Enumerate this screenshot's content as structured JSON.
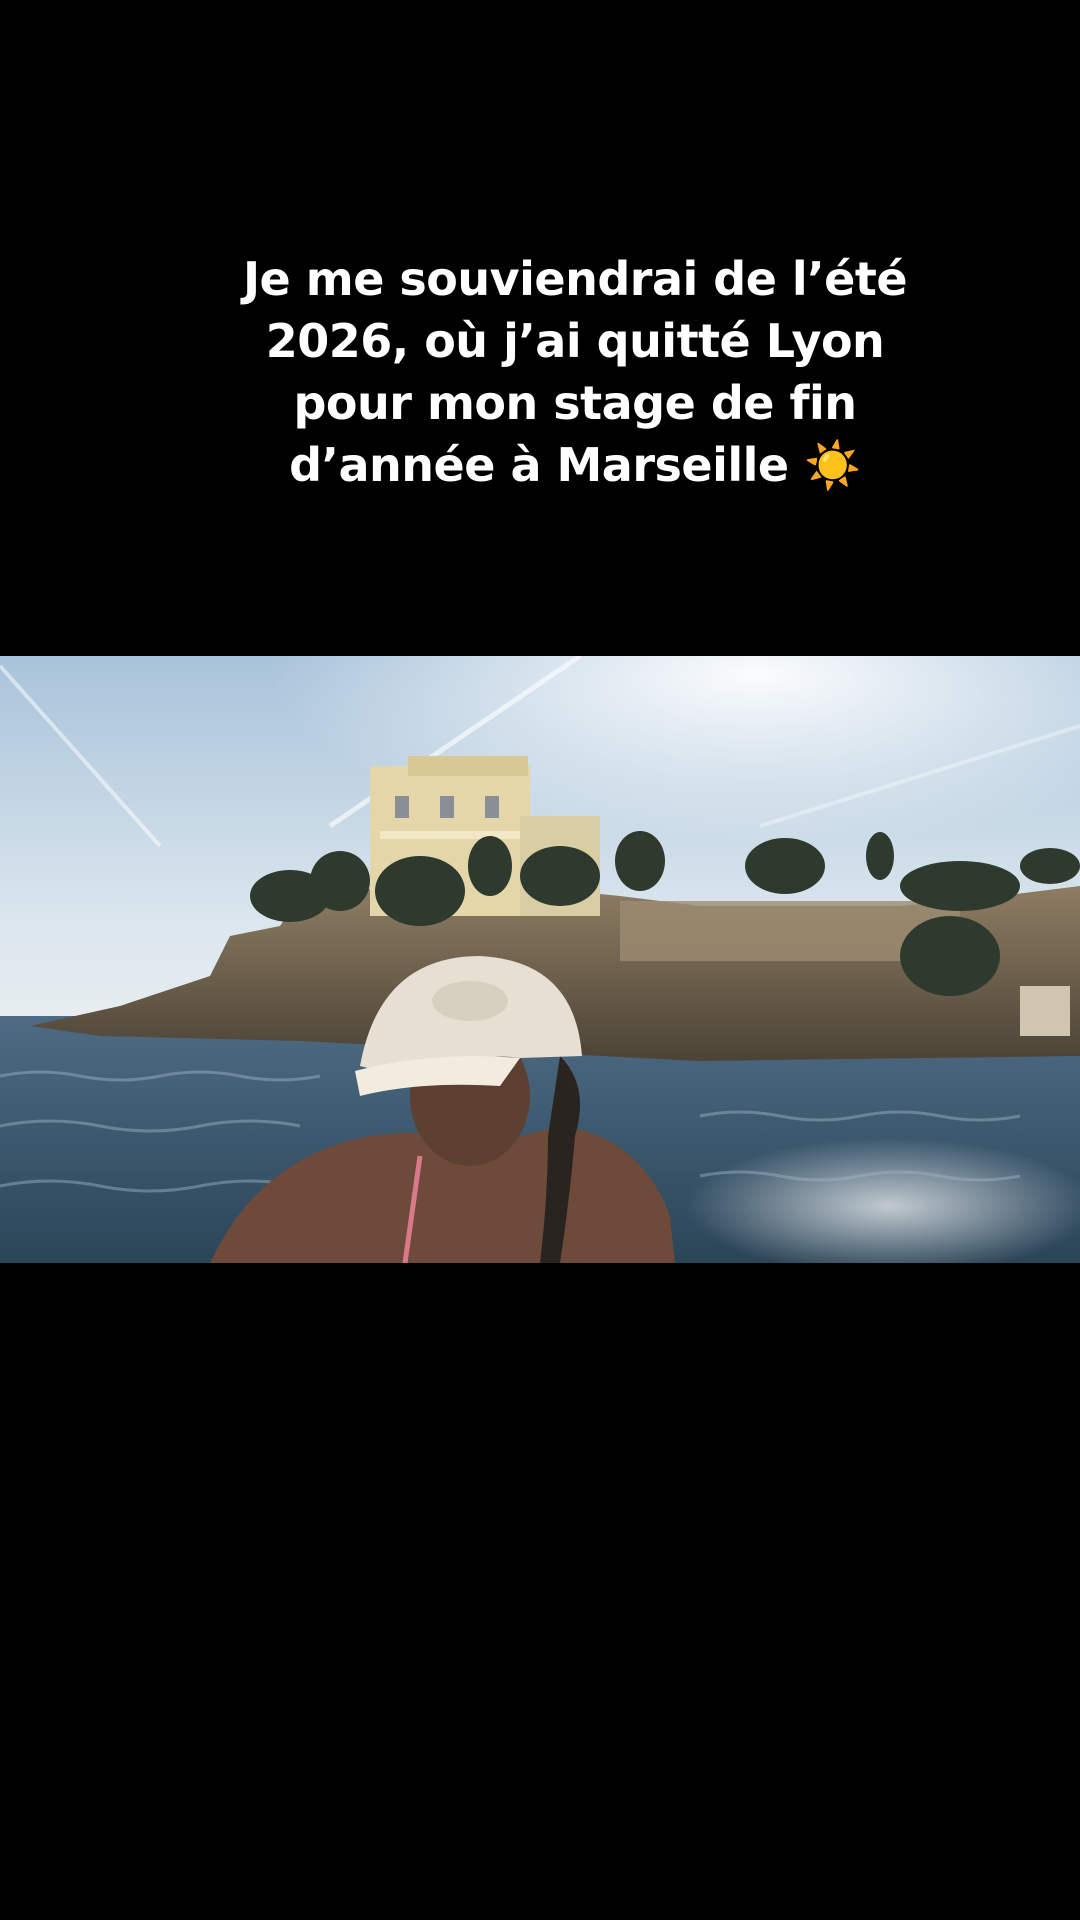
{
  "caption": {
    "lines": [
      "Je me souviendrai de l’été",
      "2026, où j’ai quitté Lyon",
      "pour mon stage de fin",
      "d’année à Marseille ☀️"
    ]
  },
  "colors": {
    "background": "#000000",
    "caption_text": "#ffffff",
    "sky_top": "#9fbcd6",
    "sky_bottom": "#dfe9ef",
    "sea": "#3a5a73",
    "rock": "#7a6a55",
    "villa": "#e8d9a8"
  },
  "video": {
    "scene_icon": "photo-frame"
  }
}
